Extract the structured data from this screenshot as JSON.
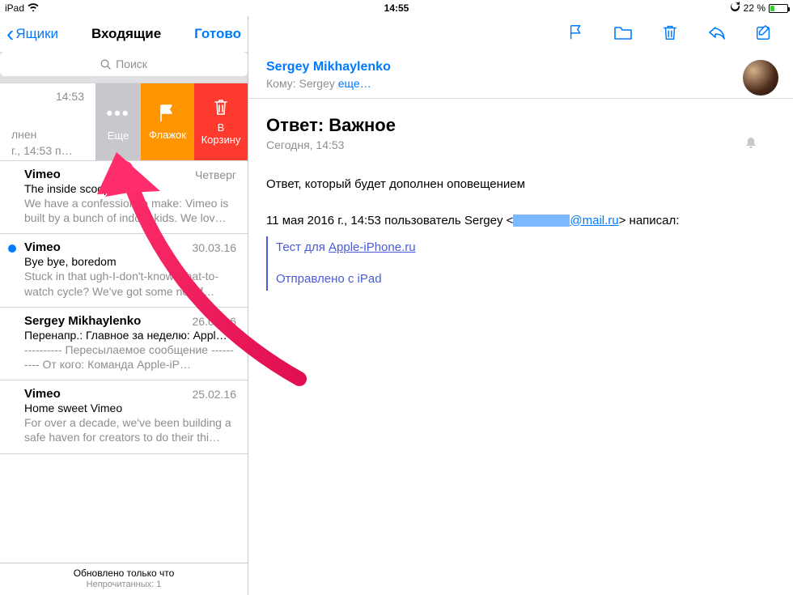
{
  "statusbar": {
    "device": "iPad",
    "time": "14:55",
    "sync_icon": "sync",
    "battery_pct": "22 %"
  },
  "nav": {
    "back": "Ящики",
    "title": "Входящие",
    "done": "Готово"
  },
  "search": {
    "placeholder": "Поиск"
  },
  "swipe": {
    "time": "14:53",
    "preview_l1": "лнен",
    "preview_l2": "г., 14:53 п…",
    "more": "Еще",
    "flag": "Флажок",
    "trash_l1": "В",
    "trash_l2": "Корзину"
  },
  "rows": [
    {
      "from": "Vimeo",
      "time": "Четверг",
      "subj": "The inside scoop",
      "prev": "We have a confession to make: Vimeo is built by a bunch of indoor kids. We lov…",
      "unread": false
    },
    {
      "from": "Vimeo",
      "time": "30.03.16",
      "subj": "Bye bye, boredom",
      "prev": "Stuck in that ugh-I-don't-know-what-to-watch cycle? We've got some new f…",
      "unread": true
    },
    {
      "from": "Sergey Mikhaylenko",
      "time": "26.02.16",
      "subj": "Перенапр.: Главное за неделю: Appl…",
      "prev": "---------- Пересылаемое сообщение ---------- От кого: Команда Apple-iP…",
      "unread": false
    },
    {
      "from": "Vimeo",
      "time": "25.02.16",
      "subj": "Home sweet Vimeo",
      "prev": "For over a decade, we've been building a safe haven for creators to do their thi…",
      "unread": false
    }
  ],
  "footer": {
    "l1": "Обновлено только что",
    "l2": "Непрочитанных: 1"
  },
  "header": {
    "sender": "Sergey Mikhaylenko",
    "to_prefix": "Кому: ",
    "to_name": "Sergey",
    "to_more": "еще…"
  },
  "message": {
    "subject": "Ответ: Важное",
    "date": "Сегодня, 14:53",
    "body": "Ответ, который будет дополнен оповещением",
    "cite": "11 мая 2016 г., 14:53 пользователь Sergey <",
    "cite_domain": "@mail.ru",
    "cite_tail": "> написал:",
    "q1_pre": "Тест для ",
    "q1_link": "Apple-iPhone.ru",
    "q2": "Отправлено с iPad"
  }
}
